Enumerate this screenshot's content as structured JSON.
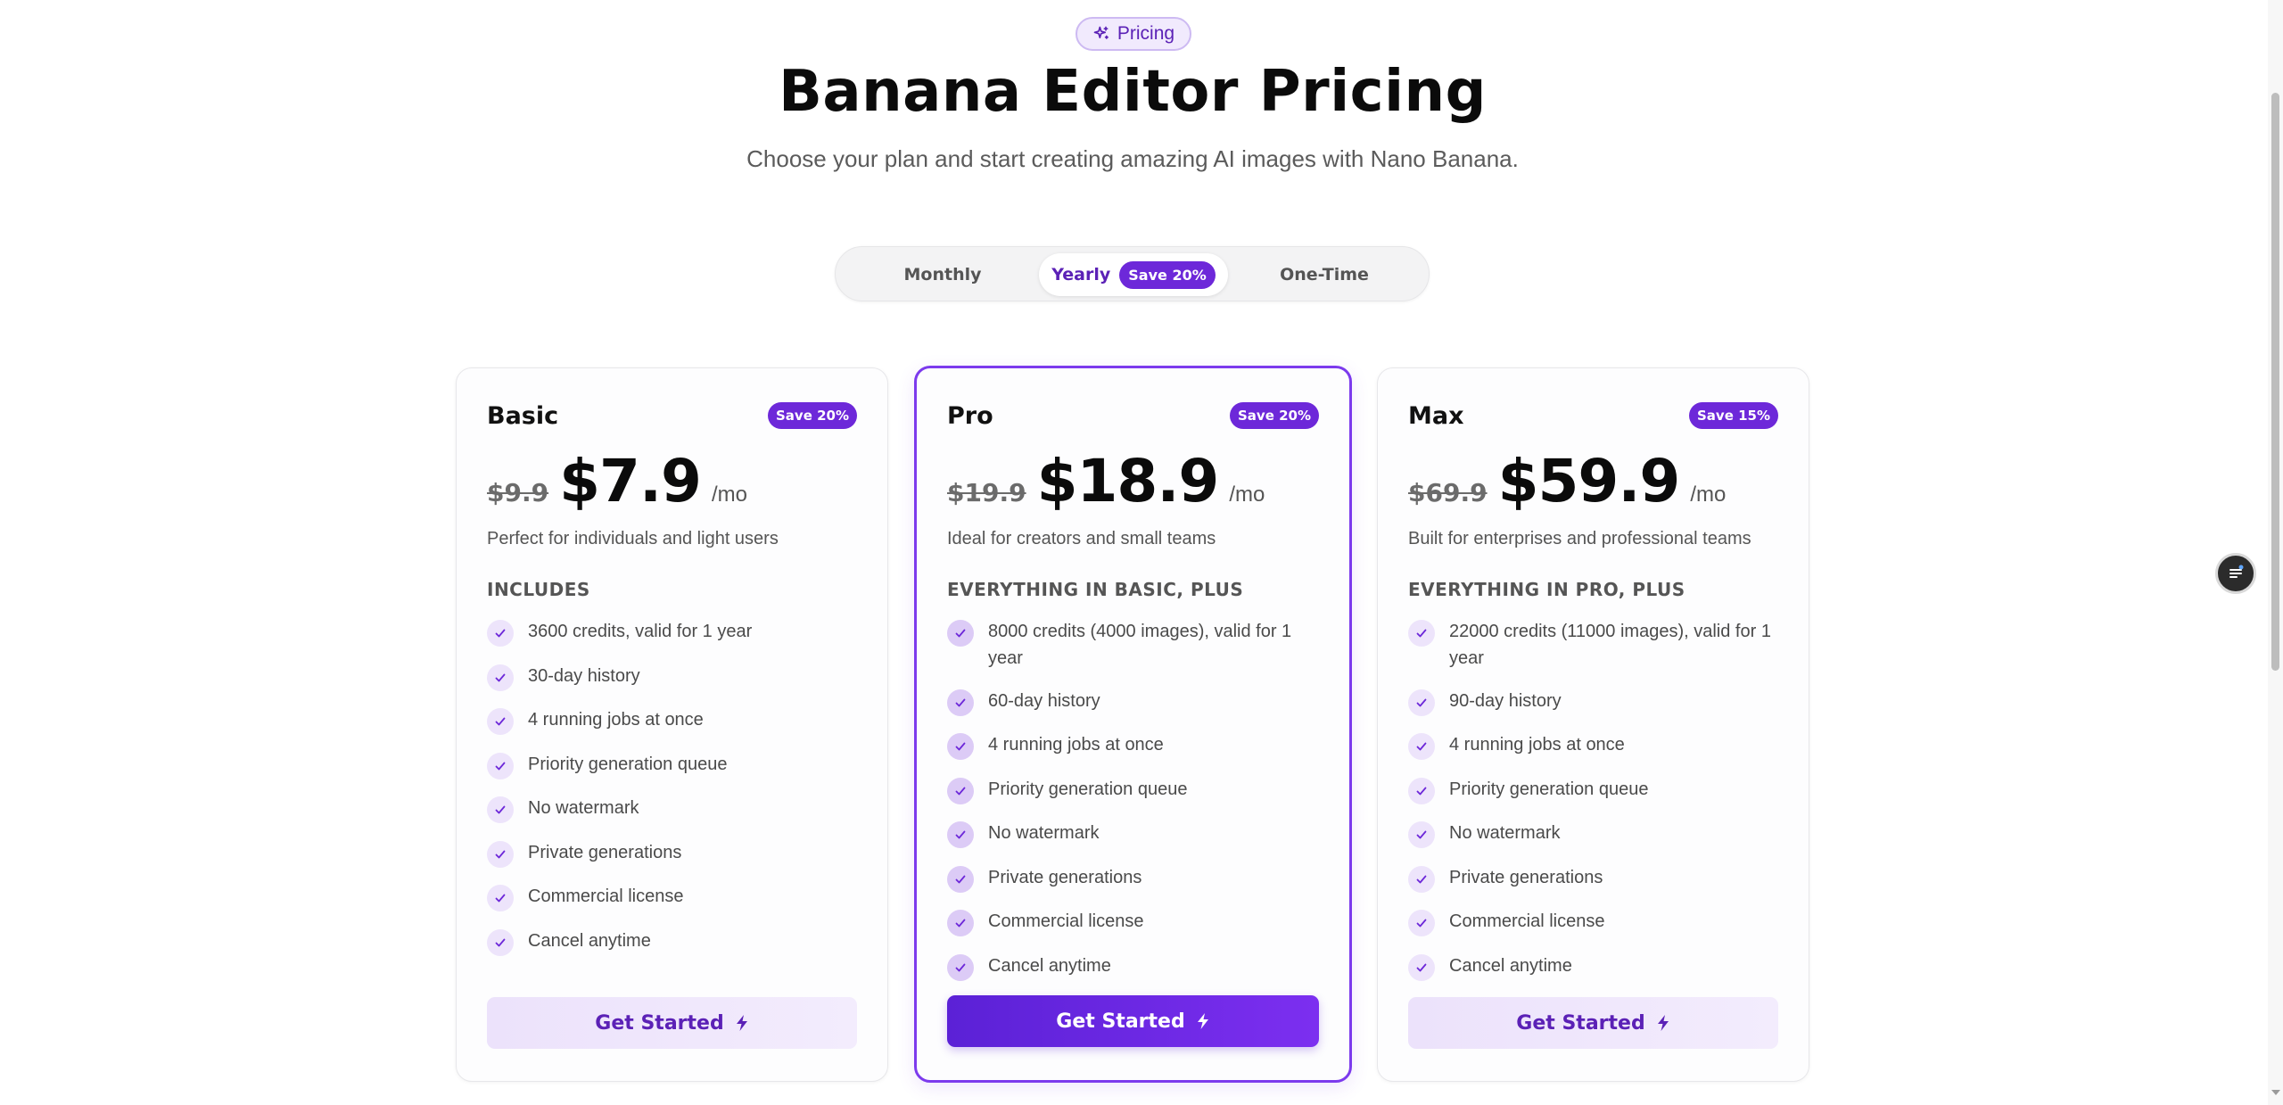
{
  "header": {
    "badge_label": "Pricing",
    "title": "Banana Editor Pricing",
    "subtitle": "Choose your plan and start creating amazing AI images with Nano Banana."
  },
  "billing_toggle": {
    "options": [
      "Monthly",
      "Yearly",
      "One-Time"
    ],
    "selected": "Yearly",
    "yearly_badge": "Save 20%"
  },
  "plans": [
    {
      "name": "Basic",
      "save_badge": "Save 20%",
      "old_price": "$9.9",
      "price": "$7.9",
      "period": "/mo",
      "description": "Perfect for individuals and light users",
      "includes_title": "INCLUDES",
      "features": [
        "3600 credits, valid for 1 year",
        "30-day history",
        "4 running jobs at once",
        "Priority generation queue",
        "No watermark",
        "Private generations",
        "Commercial license",
        "Cancel anytime"
      ],
      "cta": "Get Started",
      "highlighted": false
    },
    {
      "name": "Pro",
      "save_badge": "Save 20%",
      "old_price": "$19.9",
      "price": "$18.9",
      "period": "/mo",
      "description": "Ideal for creators and small teams",
      "includes_title": "EVERYTHING IN BASIC, PLUS",
      "features": [
        "8000 credits (4000 images), valid for 1 year",
        "60-day history",
        "4 running jobs at once",
        "Priority generation queue",
        "No watermark",
        "Private generations",
        "Commercial license",
        "Cancel anytime"
      ],
      "cta": "Get Started",
      "highlighted": true
    },
    {
      "name": "Max",
      "save_badge": "Save 15%",
      "old_price": "$69.9",
      "price": "$59.9",
      "period": "/mo",
      "description": "Built for enterprises and professional teams",
      "includes_title": "EVERYTHING IN PRO, PLUS",
      "features": [
        "22000 credits (11000 images), valid for 1 year",
        "90-day history",
        "4 running jobs at once",
        "Priority generation queue",
        "No watermark",
        "Private generations",
        "Commercial license",
        "Cancel anytime"
      ],
      "cta": "Get Started",
      "highlighted": false
    }
  ],
  "colors": {
    "accent": "#6d28d9",
    "accent_light": "#ede4fb",
    "text": "#111111",
    "muted": "#555555"
  },
  "icons": {
    "badge": "sparkles-icon",
    "check": "check-icon",
    "cta": "lightning-bolt-icon",
    "floating": "chat-menu-icon"
  }
}
